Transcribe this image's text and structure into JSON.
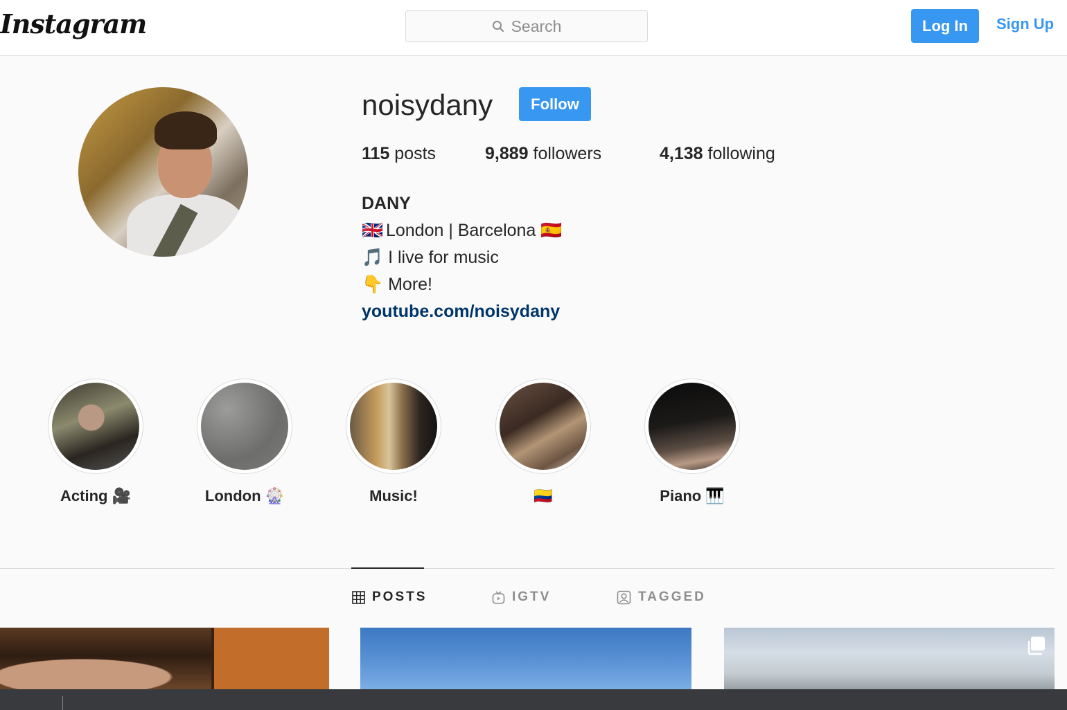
{
  "header": {
    "logo": "Instagram",
    "search_placeholder": "Search",
    "login_label": "Log In",
    "signup_label": "Sign Up"
  },
  "profile": {
    "username": "noisydany",
    "follow_label": "Follow",
    "stats": {
      "posts_count": "115",
      "posts_label": "posts",
      "followers_count": "9,889",
      "followers_label": "followers",
      "following_count": "4,138",
      "following_label": "following"
    },
    "full_name": "DANY",
    "bio": {
      "line1_emoji": "🇬🇧",
      "line1_text": "London | Barcelona",
      "line1_emoji_end": "🇪🇸",
      "line2_emoji": "🎵",
      "line2_text": "I live for music",
      "line3_emoji": "👇",
      "line3_text": "More!",
      "link": "youtube.com/noisydany"
    }
  },
  "highlights": [
    {
      "label": "Acting 🎥"
    },
    {
      "label": "London 🎡"
    },
    {
      "label": "Music!"
    },
    {
      "label": "🇨🇴"
    },
    {
      "label": "Piano 🎹"
    }
  ],
  "tabs": [
    {
      "label": "POSTS",
      "icon": "grid-icon",
      "active": true
    },
    {
      "label": "IGTV",
      "icon": "igtv-icon",
      "active": false
    },
    {
      "label": "TAGGED",
      "icon": "tagged-icon",
      "active": false
    }
  ],
  "colors": {
    "accent": "#3897f0",
    "link": "#003569",
    "text": "#262626",
    "muted": "#8e8e8e",
    "background": "#fafafa"
  }
}
